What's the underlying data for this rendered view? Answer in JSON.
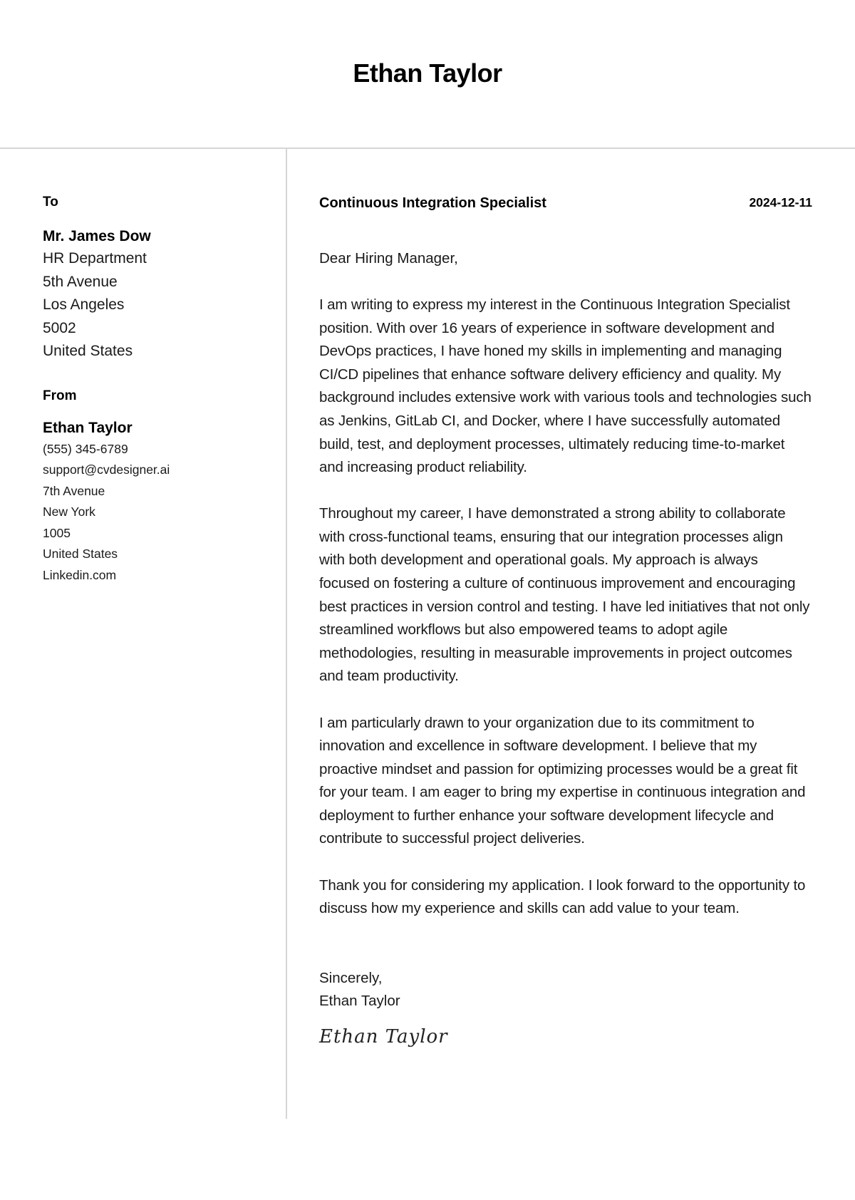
{
  "header": {
    "name": "Ethan Taylor"
  },
  "recipient": {
    "label": "To",
    "name": "Mr. James Dow",
    "lines": [
      "HR Department",
      "5th Avenue",
      "Los Angeles",
      "5002",
      "United States"
    ]
  },
  "sender": {
    "label": "From",
    "name": "Ethan Taylor",
    "phone": "(555) 345-6789",
    "email": "support@cvdesigner.ai",
    "street": "7th Avenue",
    "city": "New York",
    "zip": "1005",
    "country": "United States",
    "website": "Linkedin.com"
  },
  "letter": {
    "job_title": "Continuous Integration Specialist",
    "date": "2024-12-11",
    "greeting": "Dear Hiring Manager,",
    "paragraphs": [
      "I am writing to express my interest in the Continuous Integration Specialist position. With over 16 years of experience in software development and DevOps practices, I have honed my skills in implementing and managing CI/CD pipelines that enhance software delivery efficiency and quality. My background includes extensive work with various tools and technologies such as Jenkins, GitLab CI, and Docker, where I have successfully automated build, test, and deployment processes, ultimately reducing time-to-market and increasing product reliability.",
      "Throughout my career, I have demonstrated a strong ability to collaborate with cross-functional teams, ensuring that our integration processes align with both development and operational goals. My approach is always focused on fostering a culture of continuous improvement and encouraging best practices in version control and testing. I have led initiatives that not only streamlined workflows but also empowered teams to adopt agile methodologies, resulting in measurable improvements in project outcomes and team productivity.",
      "I am particularly drawn to your organization due to its commitment to innovation and excellence in software development. I believe that my proactive mindset and passion for optimizing processes would be a great fit for your team. I am eager to bring my expertise in continuous integration and deployment to further enhance your software development lifecycle and contribute to successful project deliveries.",
      "Thank you for considering my application. I look forward to the opportunity to discuss how my experience and skills can add value to your team."
    ],
    "closing": "Sincerely,",
    "closing_name": "Ethan Taylor",
    "signature": "Ethan Taylor"
  }
}
